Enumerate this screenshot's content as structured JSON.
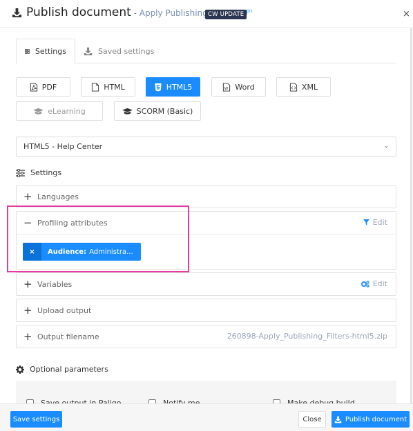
{
  "header": {
    "title": "Publish document",
    "subtitle": " - Apply Publishing Filters",
    "badge": "CW UPDATE",
    "version_marker": "P¹",
    "close_label": "×"
  },
  "tabs": [
    {
      "label": "Settings",
      "icon": "grid-icon",
      "active": true
    },
    {
      "label": "Saved settings",
      "icon": "download-icon",
      "active": false
    }
  ],
  "formats": [
    {
      "label": "PDF",
      "icon": "pdf-file-icon",
      "state": "default"
    },
    {
      "label": "HTML",
      "icon": "file-icon",
      "state": "default"
    },
    {
      "label": "HTML5",
      "icon": "html5-icon",
      "state": "selected"
    },
    {
      "label": "Word",
      "icon": "word-file-icon",
      "state": "default"
    },
    {
      "label": "XML",
      "icon": "xml-file-icon",
      "state": "default"
    },
    {
      "label": "eLearning",
      "icon": "graduation-cap-icon",
      "state": "disabled"
    },
    {
      "label": "SCORM (Basic)",
      "icon": "graduation-cap-icon",
      "state": "default"
    }
  ],
  "layout_select": {
    "value": "HTML5 - Help Center",
    "chevron": "⌄"
  },
  "settings": {
    "label": "Settings",
    "panels": {
      "languages": {
        "label": "Languages",
        "sign": "+"
      },
      "profiling": {
        "label": "Profiling attributes",
        "sign": "−",
        "action": "Edit",
        "chip": {
          "remove": "×",
          "key": "Audience:",
          "value": "Administra..."
        }
      },
      "variables": {
        "label": "Variables",
        "sign": "+",
        "action": "Edit"
      },
      "upload": {
        "label": "Upload output",
        "sign": "+"
      },
      "filename": {
        "label": "Output filename",
        "sign": "+",
        "value": "260898-Apply_Publishing_Filters-html5.zip"
      }
    }
  },
  "optional": {
    "label": "Optional parameters",
    "checkboxes": [
      {
        "label": "Save output in Paligo",
        "checked": false
      },
      {
        "label": "Notify me",
        "checked": false
      },
      {
        "label": "Make debug build",
        "checked": false
      }
    ]
  },
  "footer": {
    "save_settings": "Save settings",
    "close": "Close",
    "publish": "Publish document"
  },
  "colors": {
    "accent": "#1a8cff",
    "badge_bg": "#2c3550",
    "highlight": "#e23aa0"
  }
}
